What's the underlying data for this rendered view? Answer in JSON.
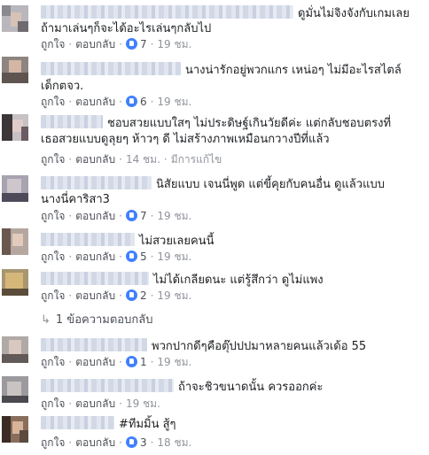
{
  "actions": {
    "like": "ถูกใจ",
    "reply": "ตอบกลับ",
    "sep": "·"
  },
  "comments": [
    {
      "line1": "ดูมั่นไม่จิงจังกับเกมเลย",
      "line2": "ถ้ามาเล่นๆก็จะได้อะไรเล่นๆกลับไป",
      "likes": "7",
      "time": "19 ชม."
    },
    {
      "line1": "นางน่ารักอยู่พวกแกร เหน่อๆ ไม่มีอะไรสไตล์",
      "line2": "เด็กตจว.",
      "likes": "6",
      "time": "19 ชม."
    },
    {
      "line1": "ชอบสวยแบบใสๆ ไม่ประดิษฐ์เกินวัยดีค่ะ แต่กลับชอบตรงที่",
      "line2": "เธอสวยแบบดูลุยๆ ห้าวๆ ดี ไม่สร้างภาพเหมือนกวางปีที่แล้ว",
      "likes": "",
      "time": "14 ชม.",
      "edited": "มีการแก้ไข"
    },
    {
      "line1": "นิสัยแบบ เจนนี่พูด แต่ขี้คุยกับคนอื่น ดูแล้วแบบ",
      "line2": "นางนี่คาริสา3",
      "likes": "7",
      "time": "19 ชม."
    },
    {
      "line1": "ไม่สวยเลยคนนี้",
      "likes": "5",
      "time": "19 ชม."
    },
    {
      "line1": "ไม่ได้เกลียดนะ แต่รู้สึกว่า ดูไม่แพง",
      "likes": "2",
      "time": "19 ชม."
    },
    {
      "line1": "พวกปากดีๆคือตุ๊ปปปมาหลายคนแล้วเด้อ 55",
      "likes": "1",
      "time": "19 ชม."
    },
    {
      "line1": "ถ้าจะชิวขนาดนั้น ควรออกค่ะ",
      "likes": "",
      "time": "19 ชม."
    },
    {
      "line1": "#ทีมมิ้น สู้ๆ",
      "likes": "3",
      "time": "18 ชม."
    }
  ],
  "reply_thread": {
    "arrow": "↳",
    "label": "1 ข้อความตอบกลับ"
  },
  "colors": {
    "link": "#4b4f56",
    "meta": "#90949c",
    "like": "#4080ff"
  }
}
